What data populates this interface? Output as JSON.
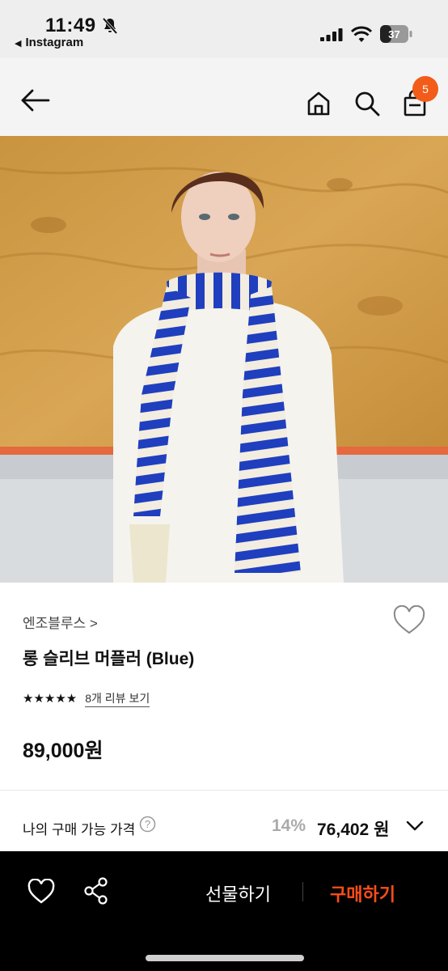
{
  "status_bar": {
    "time": "11:49",
    "back_app": "Instagram",
    "battery": "37"
  },
  "nav": {
    "cart_count": "5",
    "icons": [
      "back-arrow-icon",
      "home-icon",
      "search-icon",
      "shopping-bag-icon"
    ]
  },
  "product": {
    "brand": "엔조블루스 >",
    "name": "롱 슬리브 머플러 (Blue)",
    "stars": "★★★★★",
    "review_link": "8개 리뷰 보기",
    "price": "89,000원"
  },
  "my_price": {
    "label": "나의 구매 가능 가격",
    "discount": "14%",
    "value": "76,402 원"
  },
  "bottom_bar": {
    "gift_label": "선물하기",
    "buy_label": "구매하기"
  },
  "colors": {
    "accent": "#ff4d1a",
    "badge": "#f25c18",
    "bottom_bar_bg": "#000000"
  }
}
